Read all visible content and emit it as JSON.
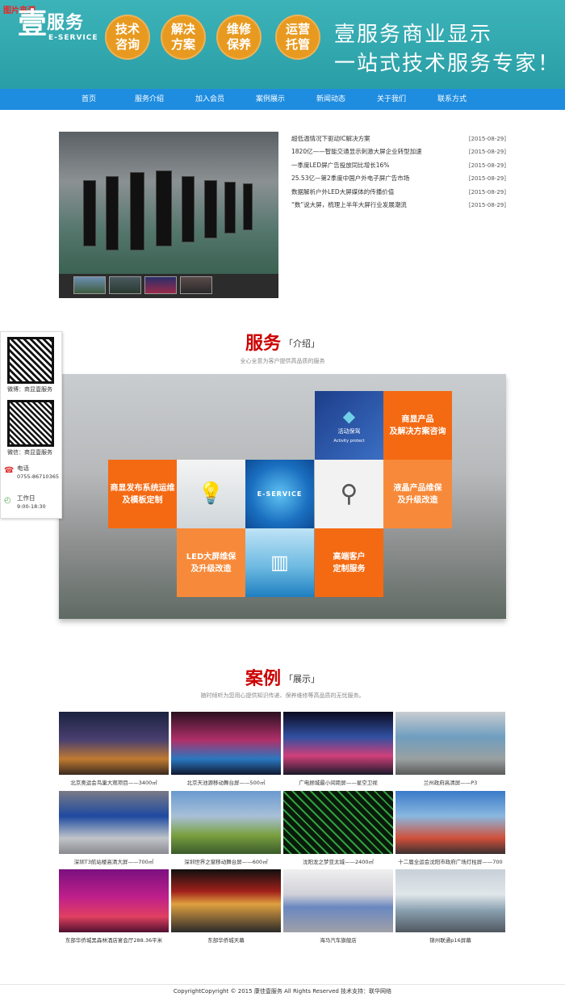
{
  "corner_tag": "图片来源",
  "logo": {
    "mark": "壹",
    "text": "服务",
    "sub": "E-SERVICE"
  },
  "header_badges": [
    {
      "line1": "技术",
      "line2": "咨询",
      "color": "#e89a20"
    },
    {
      "line1": "解决",
      "line2": "方案",
      "color": "#e89a20"
    },
    {
      "line1": "维修",
      "line2": "保养",
      "color": "#e89a20"
    },
    {
      "line1": "运营",
      "line2": "托管",
      "color": "#e89a20"
    }
  ],
  "slogan": {
    "line1": "壹服务商业显示",
    "line2": "一站式技术服务专家！"
  },
  "nav": [
    "首页",
    "服务介绍",
    "加入会员",
    "案例展示",
    "新闻动态",
    "关于我们",
    "联系方式"
  ],
  "news": [
    {
      "title": "超低温情况下驱动IC解决方案",
      "date": "[2015-08-29]"
    },
    {
      "title": "1820亿——智能交通显示刺激大屏企业转型加速",
      "date": "[2015-08-29]"
    },
    {
      "title": "一季度LED屏广告投放同比增长16%",
      "date": "[2015-08-29]"
    },
    {
      "title": "25.53亿—第2季度中国户外电子屏广告市场",
      "date": "[2015-08-29]"
    },
    {
      "title": "数据解析户外LED大屏媒体的传播价值",
      "date": "[2015-08-29]"
    },
    {
      "title": "“数”说大屏，梳理上半年大屏行业发展潮流",
      "date": "[2015-08-29]"
    }
  ],
  "services_section": {
    "title_big": "服务",
    "title_small": "「介绍」",
    "subtitle": "全心全意为客户提供高品质的服务",
    "tiles": {
      "t1": "商显产品及解决方案咨询",
      "t1a": "商显产品",
      "t1b": "及解决方案咨询",
      "t2a": "商显发布系统运维",
      "t2b": "及模板定制",
      "t3a": "液晶产品维保",
      "t3b": "及升级改造",
      "t4a": "LED大屏维保",
      "t4b": "及升级改造",
      "t5a": "高端客户",
      "t5b": "定制服务",
      "activity_cn": "活动保驾",
      "activity_en": "Activity protect",
      "eservice": "E-SERVICE"
    }
  },
  "side_widget": {
    "weibo": "微博：商显壹服务",
    "wechat": "微信：商显壹服务",
    "phone_label": "电话",
    "phone": "0755-86710365",
    "hours_label": "工作日",
    "hours": "9:00-18:30"
  },
  "cases_section": {
    "title_big": "案例",
    "title_small": "「展示」",
    "subtitle": "随时倾听为您用心提供知识传递、保养维修等高品质的无忧服务。",
    "items": [
      "北京奥运会鸟巢大观项目——3400㎡",
      "北京天池源移动舞台屏——500㎡",
      "广电顾城最小间距屏——星空卫视",
      "兰州政府高清屏——P3",
      "深圳T3航站楼高清大屏——700㎡",
      "深圳世界之窗移动舞台屏——600㎡",
      "沈阳龙之梦亚太城——2400㎡",
      "十二届全运会沈阳市政府广场灯柱屏——700",
      "东部华侨城黑森林酒店宴会厅288.36平米",
      "东部华侨城天幕",
      "海马汽车旗舰店",
      "锦州联通p16屏幕"
    ]
  },
  "footer": "CopyrightCopyright © 2015 康佳壹服务 All Rights Reserved 技术支持：联华网络"
}
